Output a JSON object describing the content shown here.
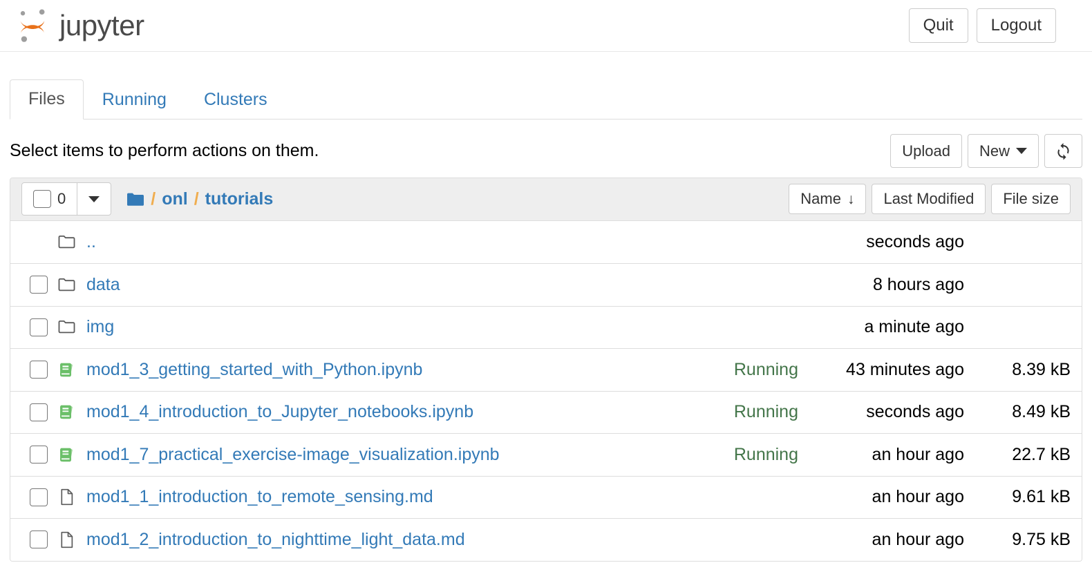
{
  "header": {
    "brand_text": "jupyter",
    "logo_icon": "jupyter-logo-icon",
    "quit_label": "Quit",
    "logout_label": "Logout"
  },
  "tabs": [
    {
      "label": "Files",
      "active": true
    },
    {
      "label": "Running",
      "active": false
    },
    {
      "label": "Clusters",
      "active": false
    }
  ],
  "action_bar": {
    "instruction": "Select items to perform actions on them.",
    "upload_label": "Upload",
    "new_label": "New",
    "new_caret_icon": "chevron-down-icon",
    "refresh_icon": "refresh-icon",
    "refresh_glyph": "↻"
  },
  "list_toolbar": {
    "select_all_count": "0",
    "select_all_checkbox_icon": "checkbox-icon",
    "select_dropdown_icon": "chevron-down-icon",
    "breadcrumb": {
      "home_icon": "folder-icon",
      "separator": "/",
      "items": [
        {
          "label": "onl"
        },
        {
          "label": "tutorials"
        }
      ]
    },
    "sort_buttons": [
      {
        "label": "Name",
        "sort_arrow": "↓",
        "active": true
      },
      {
        "label": "Last Modified",
        "sort_arrow": "",
        "active": false
      },
      {
        "label": "File size",
        "sort_arrow": "",
        "active": false
      }
    ]
  },
  "colors": {
    "link_blue": "#337ab7",
    "running_green": "#44764a",
    "notebook_green": "#6bbf69",
    "folder_gray": "#5a5a5a",
    "breadcrumb_sep": "#f0ad4e",
    "toolbar_bg": "#eeeeee",
    "border": "#dddddd",
    "jupyter_orange": "#e8711a"
  },
  "files": [
    {
      "name": "..",
      "icon": "folder-icon",
      "type": "parent-directory",
      "has_checkbox": false,
      "running": "",
      "modified": "seconds ago",
      "size": ""
    },
    {
      "name": "data",
      "icon": "folder-icon",
      "type": "directory",
      "has_checkbox": true,
      "running": "",
      "modified": "8 hours ago",
      "size": ""
    },
    {
      "name": "img",
      "icon": "folder-icon",
      "type": "directory",
      "has_checkbox": true,
      "running": "",
      "modified": "a minute ago",
      "size": ""
    },
    {
      "name": "mod1_3_getting_started_with_Python.ipynb",
      "icon": "notebook-icon",
      "type": "notebook",
      "has_checkbox": true,
      "running": "Running",
      "modified": "43 minutes ago",
      "size": "8.39 kB"
    },
    {
      "name": "mod1_4_introduction_to_Jupyter_notebooks.ipynb",
      "icon": "notebook-icon",
      "type": "notebook",
      "has_checkbox": true,
      "running": "Running",
      "modified": "seconds ago",
      "size": "8.49 kB"
    },
    {
      "name": "mod1_7_practical_exercise-image_visualization.ipynb",
      "icon": "notebook-icon",
      "type": "notebook",
      "has_checkbox": true,
      "running": "Running",
      "modified": "an hour ago",
      "size": "22.7 kB"
    },
    {
      "name": "mod1_1_introduction_to_remote_sensing.md",
      "icon": "file-icon",
      "type": "file",
      "has_checkbox": true,
      "running": "",
      "modified": "an hour ago",
      "size": "9.61 kB"
    },
    {
      "name": "mod1_2_introduction_to_nighttime_light_data.md",
      "icon": "file-icon",
      "type": "file",
      "has_checkbox": true,
      "running": "",
      "modified": "an hour ago",
      "size": "9.75 kB"
    }
  ]
}
